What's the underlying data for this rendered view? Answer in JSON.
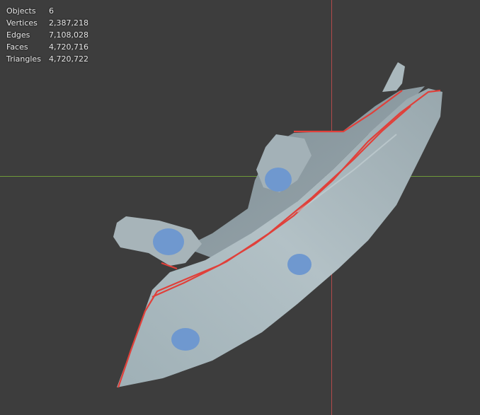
{
  "statistics": [
    {
      "label": "Objects",
      "value": "6"
    },
    {
      "label": "Vertices",
      "value": "2,387,218"
    },
    {
      "label": "Edges",
      "value": "7,108,028"
    },
    {
      "label": "Faces",
      "value": "4,720,716"
    },
    {
      "label": "Triangles",
      "value": "4,720,722"
    }
  ],
  "colors": {
    "background": "#3d3d3d",
    "x_axis": "#6f9a3a",
    "y_axis": "#b24a4a",
    "mesh": "#a9b7bd",
    "highlight": "#e0403a",
    "blue_marker": "#6f98cf"
  }
}
